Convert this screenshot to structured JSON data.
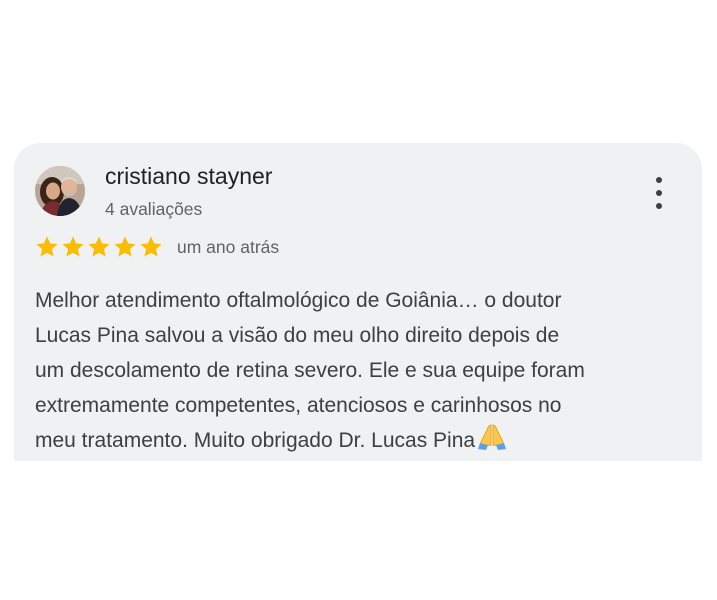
{
  "review": {
    "reviewer_name": "cristiano stayner",
    "review_count": "4 avaliações",
    "rating": 5,
    "max_rating": 5,
    "date": "um ano atrás",
    "text_lines": [
      "Melhor atendimento oftalmológico de Goiânia… o doutor",
      "Lucas Pina salvou a visão do meu olho direito depois de",
      "um descolamento de retina severo. Ele e sua equipe foram",
      "extremamente competentes, atenciosos e carinhosos no",
      "meu tratamento. Muito obrigado Dr. Lucas Pina"
    ],
    "emoji": "folded-hands-emoji"
  },
  "icons": {
    "menu": "more-vert-icon",
    "star": "star-icon"
  },
  "colors": {
    "card_background": "#eff1f3",
    "star": "#fbbc04",
    "name_text": "#202124",
    "secondary_text": "#5f6368",
    "body_text": "#3c4043"
  }
}
